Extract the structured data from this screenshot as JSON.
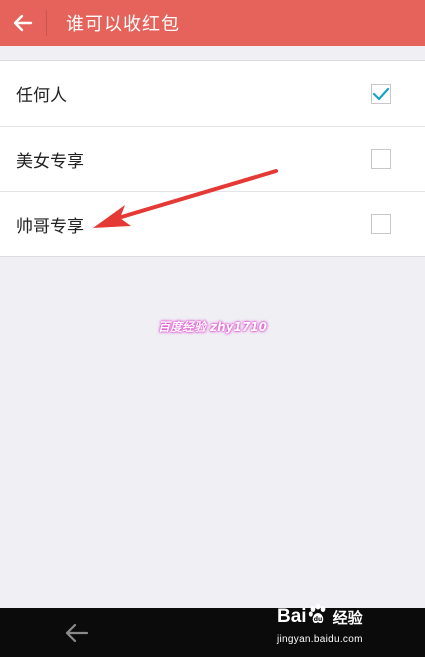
{
  "header": {
    "title": "谁可以收红包",
    "back_icon": "arrow-left-icon"
  },
  "options": [
    {
      "label": "任何人",
      "checked": true
    },
    {
      "label": "美女专享",
      "checked": false
    },
    {
      "label": "帅哥专享",
      "checked": false
    }
  ],
  "watermark": {
    "text": "百度经验 zhy1710"
  },
  "nav_bar": {
    "back_icon": "arrow-left-icon"
  },
  "baidu_jingyan": {
    "logo_text_bai": "Bai",
    "logo_text_jy": "经验",
    "url": "jingyan.baidu.com"
  },
  "colors": {
    "header_bg": "#e5635a",
    "check_accent": "#1aa3c4",
    "annotation_arrow": "#e53935",
    "background": "#efeff4"
  }
}
